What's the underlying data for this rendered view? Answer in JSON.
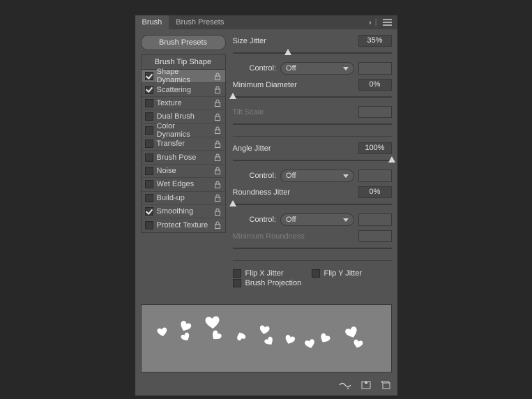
{
  "tabs": {
    "brush": "Brush",
    "presets": "Brush Presets"
  },
  "sidebar": {
    "presets_btn": "Brush Presets",
    "tipshape_btn": "Brush Tip Shape",
    "items": [
      {
        "label": "Shape Dynamics",
        "checked": true,
        "selected": true
      },
      {
        "label": "Scattering",
        "checked": true,
        "selected": false
      },
      {
        "label": "Texture",
        "checked": false,
        "selected": false
      },
      {
        "label": "Dual Brush",
        "checked": false,
        "selected": false
      },
      {
        "label": "Color Dynamics",
        "checked": false,
        "selected": false
      },
      {
        "label": "Transfer",
        "checked": false,
        "selected": false
      },
      {
        "label": "Brush Pose",
        "checked": false,
        "selected": false
      },
      {
        "label": "Noise",
        "checked": false,
        "selected": false
      },
      {
        "label": "Wet Edges",
        "checked": false,
        "selected": false
      },
      {
        "label": "Build-up",
        "checked": false,
        "selected": false
      },
      {
        "label": "Smoothing",
        "checked": true,
        "selected": false
      },
      {
        "label": "Protect Texture",
        "checked": false,
        "selected": false
      }
    ]
  },
  "settings": {
    "size_jitter": {
      "label": "Size Jitter",
      "value": "35%",
      "pos": 35
    },
    "control1": {
      "label": "Control:",
      "value": "Off"
    },
    "min_diameter": {
      "label": "Minimum Diameter",
      "value": "0%",
      "pos": 0
    },
    "tilt_scale": {
      "label": "Tilt Scale"
    },
    "angle_jitter": {
      "label": "Angle Jitter",
      "value": "100%",
      "pos": 100
    },
    "control2": {
      "label": "Control:",
      "value": "Off"
    },
    "roundness_jitter": {
      "label": "Roundness Jitter",
      "value": "0%",
      "pos": 0
    },
    "control3": {
      "label": "Control:",
      "value": "Off"
    },
    "min_roundness": {
      "label": "Minimum Roundness"
    },
    "flip_x": {
      "label": "Flip X Jitter",
      "checked": false
    },
    "flip_y": {
      "label": "Flip Y Jitter",
      "checked": false
    },
    "brush_projection": {
      "label": "Brush Projection",
      "checked": false
    }
  }
}
